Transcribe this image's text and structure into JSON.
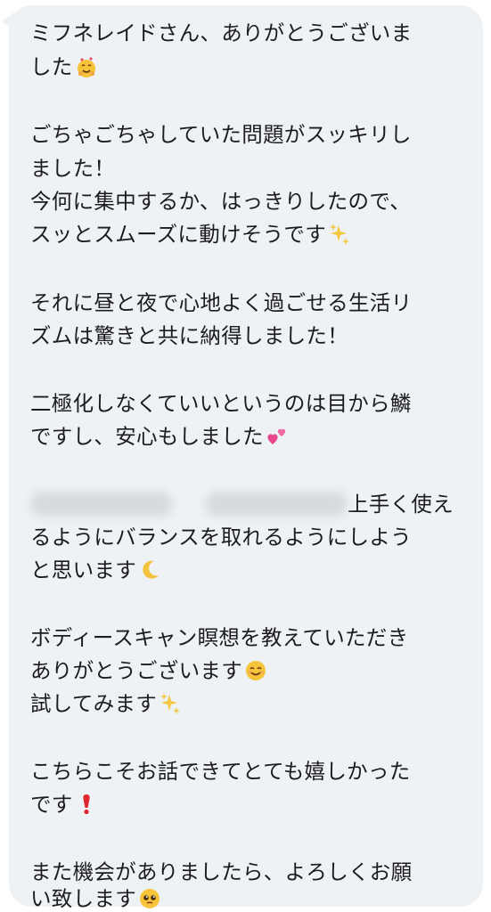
{
  "message": {
    "l1": "ミフネレイドさん、ありがとうございま",
    "l2": "した",
    "l3": "ごちゃごちゃしていた問題がスッキリし",
    "l4": "ました！",
    "l5": "今何に集中するか、はっきりしたので、",
    "l6": "スッとスムーズに動けそうです",
    "l7": "それに昼と夜で心地よく過ごせる生活リ",
    "l8": "ズムは驚きと共に納得しました！",
    "l9": "二極化しなくていいというのは目から鱗",
    "l10": "ですし、安心もしました",
    "l11_visible": "上手く使え",
    "l12": "るようにバランスを取れるようにしよう",
    "l13": "と思います",
    "l14": "ボディースキャン瞑想を教えていただき",
    "l15": "ありがとうございます",
    "l16": "試してみます",
    "l17": "こちらこそお話できてとても嬉しかった",
    "l18": "です",
    "l19": "また機会がありましたら、よろしくお願",
    "l20": "い致します"
  },
  "emojis": {
    "l2": "hearts-face-emoji",
    "l6": "sparkles-emoji",
    "l10": "two-hearts-emoji",
    "l13": "crescent-moon-emoji",
    "l15": "smiling-face-emoji",
    "l16": "sparkles-emoji",
    "l18": "exclamation-emoji",
    "l20": "pleading-face-emoji"
  },
  "colors": {
    "bubble": "#eff2f5",
    "text": "#1c1c1e"
  }
}
